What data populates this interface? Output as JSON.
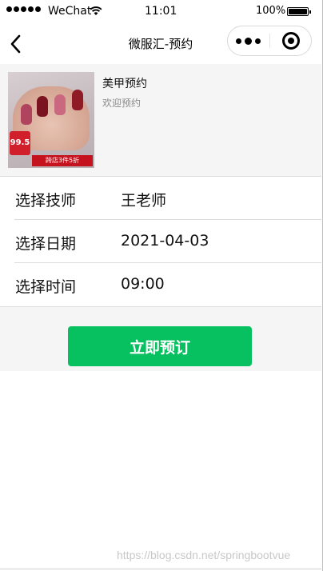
{
  "status_bar": {
    "carrier": "WeChat",
    "time": "11:01",
    "battery": "100%"
  },
  "nav": {
    "title": "微服汇-预约",
    "icons": [
      "back-icon",
      "more-icon",
      "target-icon"
    ]
  },
  "product": {
    "name": "美甲预约",
    "subtitle": "欢迎预约",
    "image_badge": "99.5",
    "image_promo": "跨店3件5折"
  },
  "form": {
    "rows": [
      {
        "label": "选择技师",
        "value": "王老师"
      },
      {
        "label": "选择日期",
        "value": "2021-04-03"
      },
      {
        "label": "选择时间",
        "value": "09:00"
      }
    ]
  },
  "actions": {
    "book_label": "立即预订"
  },
  "colors": {
    "accent": "#07c160",
    "background": "#f5f5f5"
  },
  "watermark": "https://blog.csdn.net/springbootvue"
}
